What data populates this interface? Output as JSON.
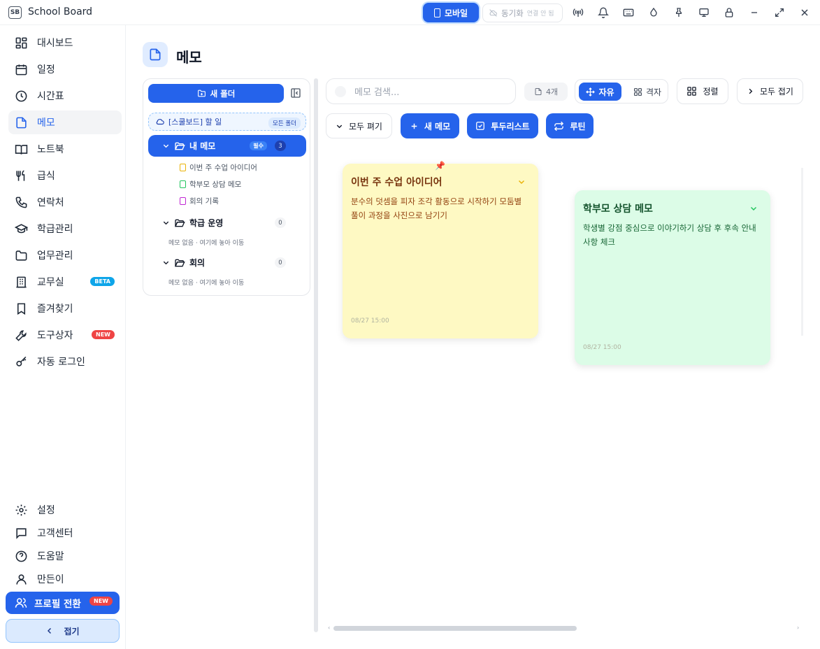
{
  "app": {
    "title": "School Board",
    "logo_text": "SB"
  },
  "titlebar": {
    "mobile_label": "모바일",
    "sync_label": "동기화",
    "sync_status": "연결 안 됨",
    "icons": [
      "antenna-icon",
      "bell-icon",
      "keyboard-icon",
      "droplet-icon",
      "pin-icon",
      "monitor-icon",
      "lock-icon",
      "minimize-icon",
      "maximize-icon",
      "close-icon"
    ]
  },
  "sidebar": {
    "items": [
      {
        "label": "대시보드",
        "icon": "dashboard-icon"
      },
      {
        "label": "일정",
        "icon": "calendar-icon"
      },
      {
        "label": "시간표",
        "icon": "clock-icon"
      },
      {
        "label": "메모",
        "icon": "memo-icon",
        "active": true
      },
      {
        "label": "노트북",
        "icon": "book-icon"
      },
      {
        "label": "급식",
        "icon": "utensils-icon"
      },
      {
        "label": "연락처",
        "icon": "phone-icon"
      },
      {
        "label": "학급관리",
        "icon": "graduation-cap-icon"
      },
      {
        "label": "업무관리",
        "icon": "folder-icon"
      },
      {
        "label": "교무실",
        "icon": "building-icon",
        "badge": "BETA"
      },
      {
        "label": "즐겨찾기",
        "icon": "bookmark-icon"
      },
      {
        "label": "도구상자",
        "icon": "wrench-icon",
        "badge": "NEW"
      },
      {
        "label": "자동 로그인",
        "icon": "key-icon"
      }
    ],
    "bottom_items": [
      {
        "label": "설정",
        "icon": "gear-icon"
      },
      {
        "label": "고객센터",
        "icon": "message-icon"
      },
      {
        "label": "도움말",
        "icon": "help-icon"
      },
      {
        "label": "만든이",
        "icon": "user-icon"
      }
    ],
    "profile_switch": {
      "label": "프로필 전환",
      "badge": "NEW"
    },
    "collapse_label": "접기"
  },
  "page": {
    "title": "메모"
  },
  "folders": {
    "new_folder_label": "새 폴더",
    "cloud": {
      "label": "[스쿨보드] 할 일",
      "tag": "모든 폴더"
    },
    "list": [
      {
        "name": "내 메모",
        "required": "필수",
        "count": "3",
        "active": true,
        "memos": [
          {
            "title": "이번 주 수업 아이디어",
            "color": "#eab308"
          },
          {
            "title": "학부모 상담 메모",
            "color": "#22c55e"
          },
          {
            "title": "회의 기록",
            "color": "#c026d3"
          }
        ]
      },
      {
        "name": "학급 운영",
        "count": "0",
        "empty_hint": "메모 없음 · 여기에 놓아 이동"
      },
      {
        "name": "회의",
        "count": "0",
        "empty_hint": "메모 없음 · 여기에 놓아 이동"
      }
    ]
  },
  "toolbar": {
    "search_placeholder": "메모 검색...",
    "memo_count": "4개",
    "mode_free": "자유",
    "mode_grid": "격자",
    "sort_label": "정렬",
    "collapse_all": "모두 접기",
    "expand_all": "모두 펴기",
    "new_memo": "새 메모",
    "todo_list": "투두리스트",
    "routine": "루틴"
  },
  "notes": [
    {
      "title": "이번 주 수업 아이디어",
      "body": "분수의 덧셈을 피자 조각 활동으로 시작하기 모둠별 풀이 과정을 사진으로 남기기",
      "date": "08/27 15:00",
      "bg": "#fef9c3",
      "title_color": "#78350f",
      "accent": "#eab308"
    },
    {
      "title": "학부모 상담 메모",
      "body": "학생별 강점 중심으로 이야기하기 상담 후 후속 안내 사항 체크",
      "date": "08/27 15:00",
      "bg": "#dcfce7",
      "title_color": "#14532d",
      "accent": "#22c55e"
    }
  ]
}
